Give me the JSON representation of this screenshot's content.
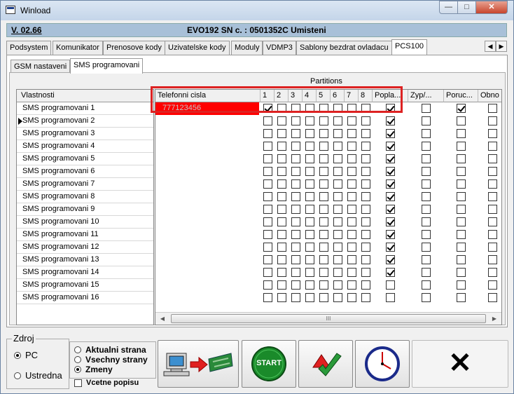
{
  "window": {
    "title": "Winload"
  },
  "titlebar_buttons": {
    "minimize": "—",
    "maximize": "□",
    "close": "✕"
  },
  "header": {
    "version": "V. 02.66",
    "device": "EVO192  SN c. : 0501352C Umisteni"
  },
  "main_tabs": [
    {
      "label": "Podsystem"
    },
    {
      "label": "Komunikator"
    },
    {
      "label": "Prenosove kody"
    },
    {
      "label": "Uzivatelske kody"
    },
    {
      "label": "Moduly"
    },
    {
      "label": "VDMP3"
    },
    {
      "label": "Sablony bezdrat ovladacu"
    },
    {
      "label": "PCS100",
      "active": true
    }
  ],
  "tab_scroll": {
    "left": "◀",
    "right": "▶"
  },
  "sub_tabs": [
    {
      "label": "GSM nastaveni"
    },
    {
      "label": "SMS programovani",
      "active": true
    }
  ],
  "partitions_label": "Partitions",
  "left_grid": {
    "header": "Vlastnosti",
    "rows": [
      "SMS programovani 1",
      "SMS programovani 2",
      "SMS programovani 3",
      "SMS programovani 4",
      "SMS programovani 5",
      "SMS programovani 6",
      "SMS programovani 7",
      "SMS programovani 8",
      "SMS programovani 9",
      "SMS programovani 10",
      "SMS programovani 11",
      "SMS programovani 12",
      "SMS programovani 13",
      "SMS programovani 14",
      "SMS programovani 15",
      "SMS programovani 16"
    ],
    "current_row": 1
  },
  "right_grid": {
    "headers": [
      "Telefonni cisla",
      "1",
      "2",
      "3",
      "4",
      "5",
      "6",
      "7",
      "8",
      "Popla...",
      "Zyp/...",
      "Poruc...",
      "Obno"
    ],
    "phone_numbers": [
      "777123456",
      "",
      "",
      "",
      "",
      "",
      "",
      "",
      "",
      "",
      "",
      "",
      "",
      "",
      "",
      ""
    ],
    "checked": [
      [
        1,
        0,
        0,
        0,
        0,
        0,
        0,
        0,
        1,
        0,
        1,
        0
      ],
      [
        0,
        0,
        0,
        0,
        0,
        0,
        0,
        0,
        1,
        0,
        0,
        0
      ],
      [
        0,
        0,
        0,
        0,
        0,
        0,
        0,
        0,
        1,
        0,
        0,
        0
      ],
      [
        0,
        0,
        0,
        0,
        0,
        0,
        0,
        0,
        1,
        0,
        0,
        0
      ],
      [
        0,
        0,
        0,
        0,
        0,
        0,
        0,
        0,
        1,
        0,
        0,
        0
      ],
      [
        0,
        0,
        0,
        0,
        0,
        0,
        0,
        0,
        1,
        0,
        0,
        0
      ],
      [
        0,
        0,
        0,
        0,
        0,
        0,
        0,
        0,
        1,
        0,
        0,
        0
      ],
      [
        0,
        0,
        0,
        0,
        0,
        0,
        0,
        0,
        1,
        0,
        0,
        0
      ],
      [
        0,
        0,
        0,
        0,
        0,
        0,
        0,
        0,
        1,
        0,
        0,
        0
      ],
      [
        0,
        0,
        0,
        0,
        0,
        0,
        0,
        0,
        1,
        0,
        0,
        0
      ],
      [
        0,
        0,
        0,
        0,
        0,
        0,
        0,
        0,
        1,
        0,
        0,
        0
      ],
      [
        0,
        0,
        0,
        0,
        0,
        0,
        0,
        0,
        1,
        0,
        0,
        0
      ],
      [
        0,
        0,
        0,
        0,
        0,
        0,
        0,
        0,
        1,
        0,
        0,
        0
      ],
      [
        0,
        0,
        0,
        0,
        0,
        0,
        0,
        0,
        1,
        0,
        0,
        0
      ],
      [
        0,
        0,
        0,
        0,
        0,
        0,
        0,
        0,
        0,
        0,
        0,
        0
      ],
      [
        0,
        0,
        0,
        0,
        0,
        0,
        0,
        0,
        0,
        0,
        0,
        0
      ]
    ]
  },
  "scrollbar": {
    "left": "◀",
    "right": "▶",
    "grip": "III"
  },
  "source": {
    "label": "Zdroj",
    "options": [
      {
        "label": "PC",
        "checked": true
      },
      {
        "label": "Ustredna",
        "checked": false
      }
    ]
  },
  "mode": {
    "options": [
      {
        "label": "Aktualni strana",
        "checked": false
      },
      {
        "label": "Vsechny strany",
        "checked": false
      },
      {
        "label": "Zmeny",
        "checked": true
      }
    ],
    "include_desc": {
      "label": "Vcetne popisu",
      "checked": false
    }
  },
  "toolbar": {
    "start_label": "START",
    "close_glyph": "✕",
    "colors": {
      "start": "#1a8a2a",
      "close_fg": "#000000",
      "arrow": "#e02020",
      "board": "#2a8a3a"
    },
    "icons": [
      "pc-to-panel-icon",
      "start-icon",
      "verify-icon",
      "clock-icon",
      "close-icon"
    ]
  },
  "colors": {
    "highlight": "#ff0000",
    "outline": "#dd2222",
    "header_bar": "#a8c0d8"
  }
}
